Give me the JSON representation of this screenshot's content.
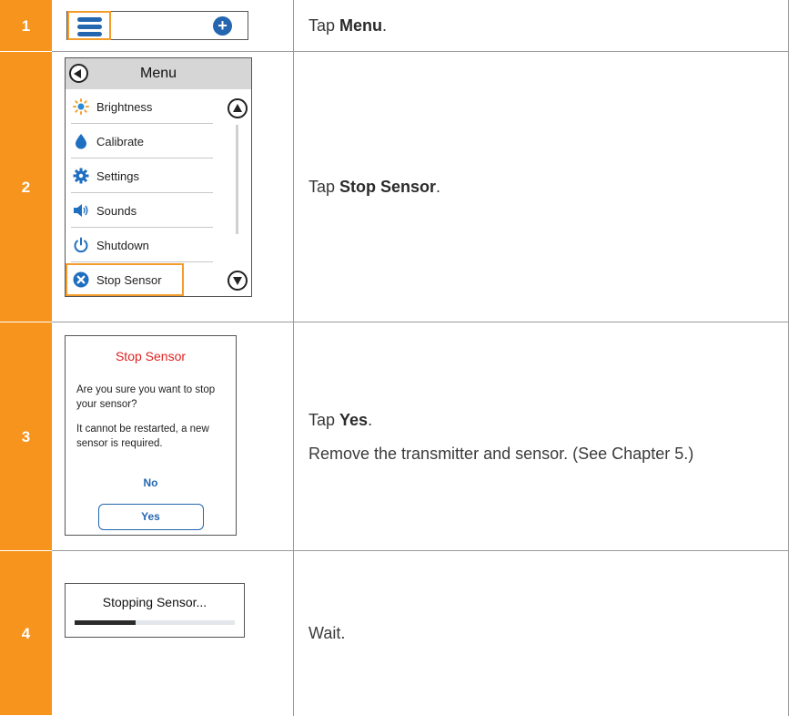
{
  "steps": [
    {
      "number": "1",
      "instruction_parts": {
        "prefix": "Tap ",
        "bold": "Menu",
        "suffix": "."
      }
    },
    {
      "number": "2",
      "instruction_parts": {
        "prefix": "Tap ",
        "bold": "Stop Sensor",
        "suffix": "."
      }
    },
    {
      "number": "3",
      "instruction_parts": {
        "prefix": "Tap ",
        "bold": "Yes",
        "suffix": "."
      },
      "extra_text": "Remove the transmitter and sensor. (See Chapter 5.)"
    },
    {
      "number": "4",
      "instruction": "Wait."
    }
  ],
  "screen1": {
    "menu_icon": "hamburger-menu-icon",
    "add_icon": "plus-circle-icon",
    "add_glyph": "+"
  },
  "menu_screen": {
    "title": "Menu",
    "items": [
      {
        "label": "Brightness",
        "icon": "brightness-icon"
      },
      {
        "label": "Calibrate",
        "icon": "drop-icon"
      },
      {
        "label": "Settings",
        "icon": "gear-icon"
      },
      {
        "label": "Sounds",
        "icon": "speaker-icon"
      },
      {
        "label": "Shutdown",
        "icon": "power-icon"
      },
      {
        "label": "Stop Sensor",
        "icon": "stop-x-icon"
      }
    ]
  },
  "stop_dialog": {
    "title": "Stop Sensor",
    "question": "Are you sure you want to stop your sensor?",
    "warning": "It cannot be restarted, a new sensor is required.",
    "no_label": "No",
    "yes_label": "Yes"
  },
  "progress_screen": {
    "label": "Stopping Sensor...",
    "progress": 0.38
  },
  "colors": {
    "step_orange": "#f7941d",
    "highlight_orange": "#f39c2b",
    "accent_blue": "#2466b0",
    "title_red": "#e02020"
  }
}
